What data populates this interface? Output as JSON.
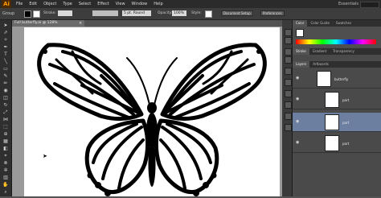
{
  "app": {
    "logo": "Ai"
  },
  "menu": [
    "File",
    "Edit",
    "Object",
    "Type",
    "Select",
    "Effect",
    "View",
    "Window",
    "Help"
  ],
  "workspace": "Essentials",
  "control_bar": {
    "selection_label": "Group",
    "stroke_label": "Stroke:",
    "brush": "5 pt. Round",
    "opacity_label": "Opacity:",
    "opacity": "100%",
    "style_label": "Style:",
    "document_setup": "Document Setup",
    "preferences": "Preferences"
  },
  "document": {
    "tab_title": "Full butterfly.ai @ 128% (CMYK/Preview)",
    "close": "×"
  },
  "panels": {
    "color_tabs": [
      "Color",
      "Color Guide",
      "Swatches"
    ],
    "layer_tabs": [
      "Stroke",
      "Gradient",
      "Transparency"
    ],
    "sub_tabs": [
      "Layers",
      "Artboards"
    ]
  },
  "layers": [
    {
      "name": "butterfly",
      "selected": false
    },
    {
      "name": "part",
      "selected": false
    },
    {
      "name": "part",
      "selected": true
    },
    {
      "name": "part",
      "selected": false
    }
  ],
  "colors": {
    "accent": "#ff9a00",
    "selection": "#6d7fa1"
  }
}
